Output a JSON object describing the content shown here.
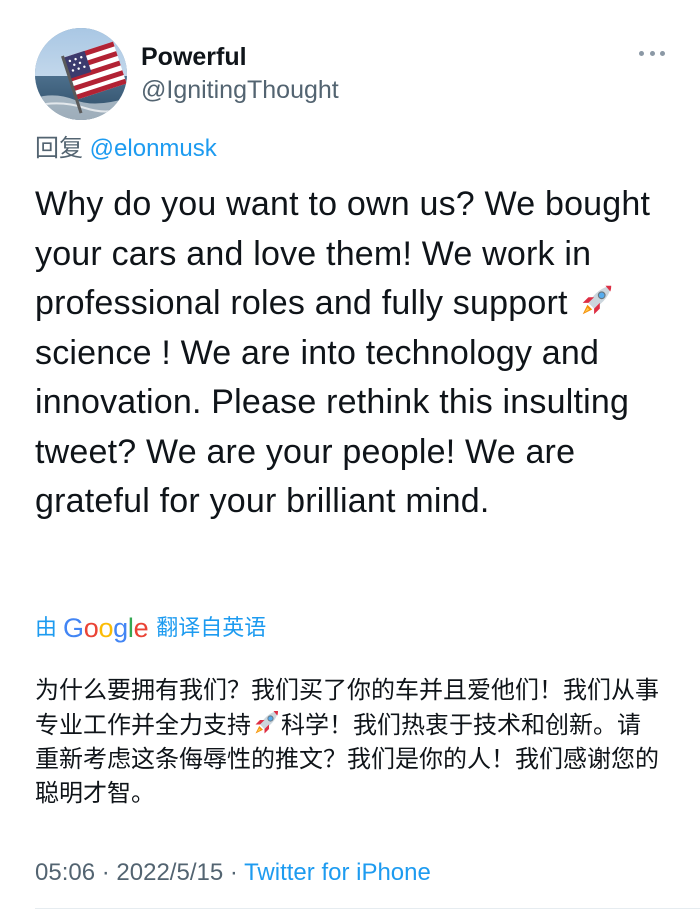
{
  "user": {
    "display_name": "Powerful",
    "handle": "@IgnitingThought"
  },
  "reply": {
    "prefix": "回复",
    "handle": "@elonmusk"
  },
  "tweet": {
    "part1": "Why do you want to own us? We bought your cars and love them! We work in professional roles and fully support",
    "part2": "science ! We are into technology and innovation. Please rethink this insulting tweet? We are your people! We are grateful for your brilliant mind."
  },
  "translation": {
    "by": "由",
    "google": [
      "G",
      "o",
      "o",
      "g",
      "l",
      "e"
    ],
    "label": "翻译自英语",
    "part1": "为什么要拥有我们？我们买了你的车并且爱他们！我们从事专业工作并全力支持",
    "part2": "科学！我们热衷于技术和创新。请重新考虑这条侮辱性的推文？我们是你的人！我们感谢您的聪明才智。"
  },
  "meta": {
    "time": "05:06",
    "date": "2022/5/15",
    "separator": "·",
    "source": "Twitter for iPhone"
  },
  "colors": {
    "link": "#1d9bf0",
    "secondary": "#536471",
    "google_blue": "#4285f4",
    "google_red": "#ea4335",
    "google_yellow": "#fbbc05",
    "google_green": "#34a853"
  },
  "icons": {
    "more": "more-horizontal-icon",
    "rocket": "rocket-emoji-icon",
    "avatar": "american-flag-avatar"
  }
}
